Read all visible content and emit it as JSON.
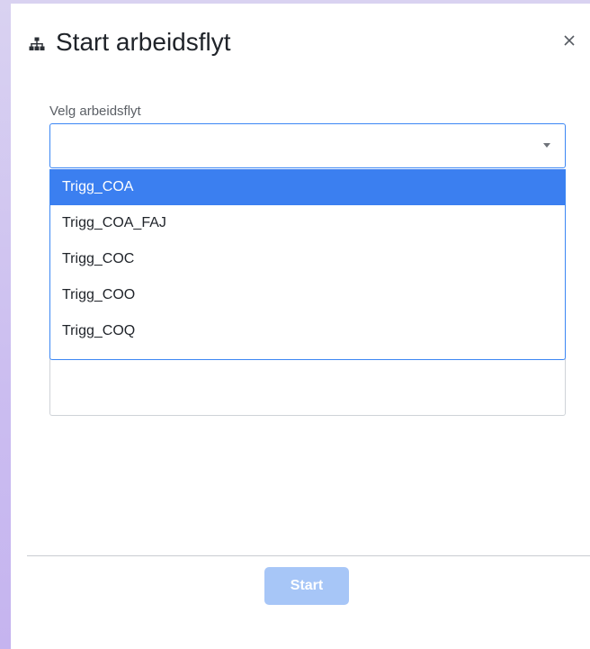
{
  "dialog": {
    "title": "Start arbeidsflyt",
    "title_icon": "workflow-hierarchy-icon",
    "close_icon": "close-icon"
  },
  "form": {
    "select_label": "Velg arbeidsflyt",
    "select_value": "",
    "options": [
      {
        "label": "Trigg_COA",
        "selected": true
      },
      {
        "label": "Trigg_COA_FAJ",
        "selected": false
      },
      {
        "label": "Trigg_COC",
        "selected": false
      },
      {
        "label": "Trigg_COO",
        "selected": false
      },
      {
        "label": "Trigg_COQ",
        "selected": false
      }
    ]
  },
  "footer": {
    "start_label": "Start",
    "start_disabled": true
  },
  "colors": {
    "accent": "#3b7ff0",
    "button_disabled": "#a7c6f7",
    "background": "#cbbdf0"
  }
}
